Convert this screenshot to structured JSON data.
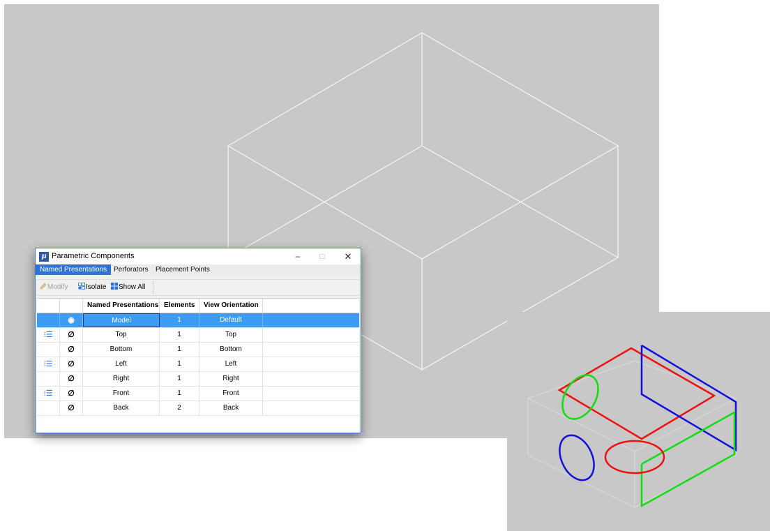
{
  "window": {
    "title": "Parametric Components",
    "app_icon_glyph": "μ",
    "controls": {
      "minimize": "–",
      "maximize": "□",
      "close": "✕"
    }
  },
  "tabs": [
    {
      "label": "Named Presentations",
      "active": true
    },
    {
      "label": "Perforators",
      "active": false
    },
    {
      "label": "Placement Points",
      "active": false
    }
  ],
  "toolbar": {
    "modify_label": "Modify",
    "isolate_label": "Isolate",
    "show_all_label": "Show All"
  },
  "table": {
    "columns": [
      "",
      "",
      "Named Presentations",
      "Elements",
      "View Orientation"
    ],
    "rows": [
      {
        "flag": "",
        "visibility": "eye-icon",
        "name": "Model",
        "elements": "1",
        "orientation": "Default",
        "selected": true
      },
      {
        "flag": "list-icon",
        "visibility": "eye-hidden-icon",
        "name": "Top",
        "elements": "1",
        "orientation": "Top",
        "selected": false
      },
      {
        "flag": "",
        "visibility": "eye-hidden-icon",
        "name": "Bottom",
        "elements": "1",
        "orientation": "Bottom",
        "selected": false
      },
      {
        "flag": "list-icon",
        "visibility": "eye-hidden-icon",
        "name": "Left",
        "elements": "1",
        "orientation": "Left",
        "selected": false
      },
      {
        "flag": "",
        "visibility": "eye-hidden-icon",
        "name": "Right",
        "elements": "1",
        "orientation": "Right",
        "selected": false
      },
      {
        "flag": "list-icon",
        "visibility": "eye-hidden-icon",
        "name": "Front",
        "elements": "1",
        "orientation": "Front",
        "selected": false
      },
      {
        "flag": "",
        "visibility": "eye-hidden-icon",
        "name": "Back",
        "elements": "2",
        "orientation": "Back",
        "selected": false
      }
    ]
  },
  "colors": {
    "viewport_bg": "#c8c8c8",
    "wireframe": "#ffffff",
    "selection": "#3d9bf2",
    "tab_active": "#2d74d6",
    "shape_red": "#ee1111",
    "shape_blue": "#1111dd",
    "shape_green": "#11dd11"
  }
}
